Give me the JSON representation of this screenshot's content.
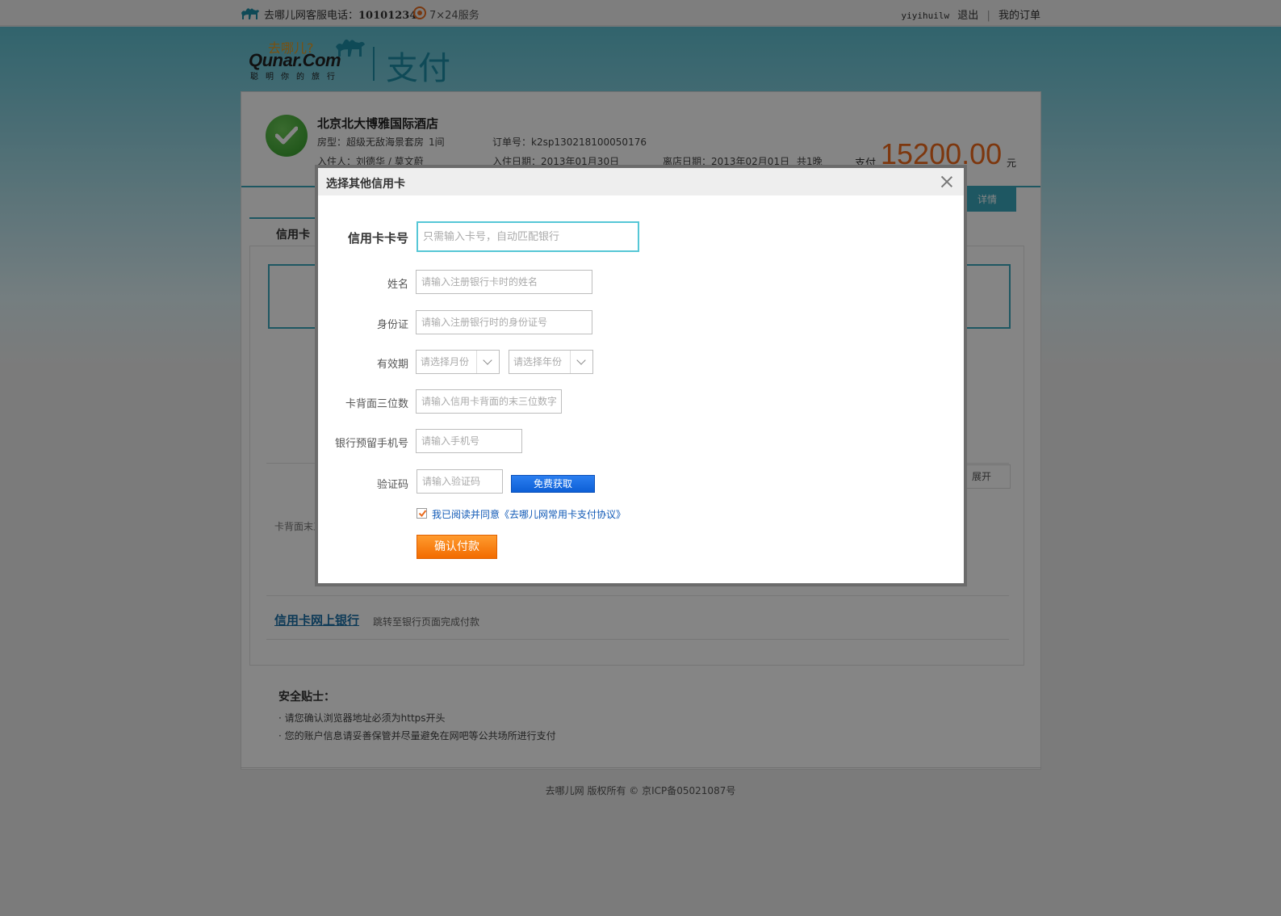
{
  "topbar": {
    "hotline_label": "去哪儿网客服电话：",
    "hotline_number": "10101234",
    "service": "7×24服务",
    "username": "yiyihuilw",
    "logout": "退出",
    "sep": "|",
    "my_orders": "我的订单"
  },
  "header": {
    "logo_cn": "去哪儿?",
    "logo_en": "Qunar.Com",
    "logo_slogan": "聪明你的旅行",
    "title": "支付"
  },
  "order": {
    "hotel_name": "北京北大博雅国际酒店",
    "room_type": "房型：超级无敌海景套房",
    "room_count": "1间",
    "order_no": "订单号：k2sp130218100050176",
    "guests": "入住人：刘德华 / 莫文蔚",
    "checkin": "入住日期：2013年01月30日",
    "checkout": "离店日期：2013年02月01日",
    "nights": "共1晚",
    "pay_label": "支付",
    "amount": "15200.00",
    "currency": "元",
    "detail_btn": "详情"
  },
  "payment": {
    "tab_credit_card": "信用卡",
    "expand": "展开",
    "cvv_hint": "卡背面末三",
    "netbank_label": "信用卡网上银行",
    "netbank_sub": "跳转至银行页面完成付款"
  },
  "tips": {
    "title": "安全贴士：",
    "items": [
      "· 请您确认浏览器地址必须为https开头",
      "· 您的账户信息请妥善保管并尽量避免在网吧等公共场所进行支付"
    ]
  },
  "footer": {
    "copyright": "去哪儿网 版权所有 © 京ICP备05021087号"
  },
  "modal": {
    "title": "选择其他信用卡",
    "card_no_label": "信用卡卡号",
    "card_no_placeholder": "只需输入卡号，自动匹配银行",
    "name_label": "姓名",
    "name_placeholder": "请输入注册银行卡时的姓名",
    "id_label": "身份证",
    "id_placeholder": "请输入注册银行时的身份证号",
    "expiry_label": "有效期",
    "month_placeholder": "请选择月份",
    "year_placeholder": "请选择年份",
    "cvv_label": "卡背面三位数",
    "cvv_placeholder": "请输入信用卡背面的末三位数字",
    "phone_label": "银行预留手机号",
    "phone_placeholder": "请输入手机号",
    "code_label": "验证码",
    "code_placeholder": "请输入验证码",
    "sms_button": "免费获取",
    "agree_checked": true,
    "agree_text": "我已阅读并同意《去哪儿网常用卡支付协议》",
    "confirm_button": "确认付款"
  },
  "colors": {
    "accent": "#3aa8bc",
    "amount": "#f06a1b",
    "confirm": "#f26b00",
    "sms": "#0d5fd6"
  }
}
